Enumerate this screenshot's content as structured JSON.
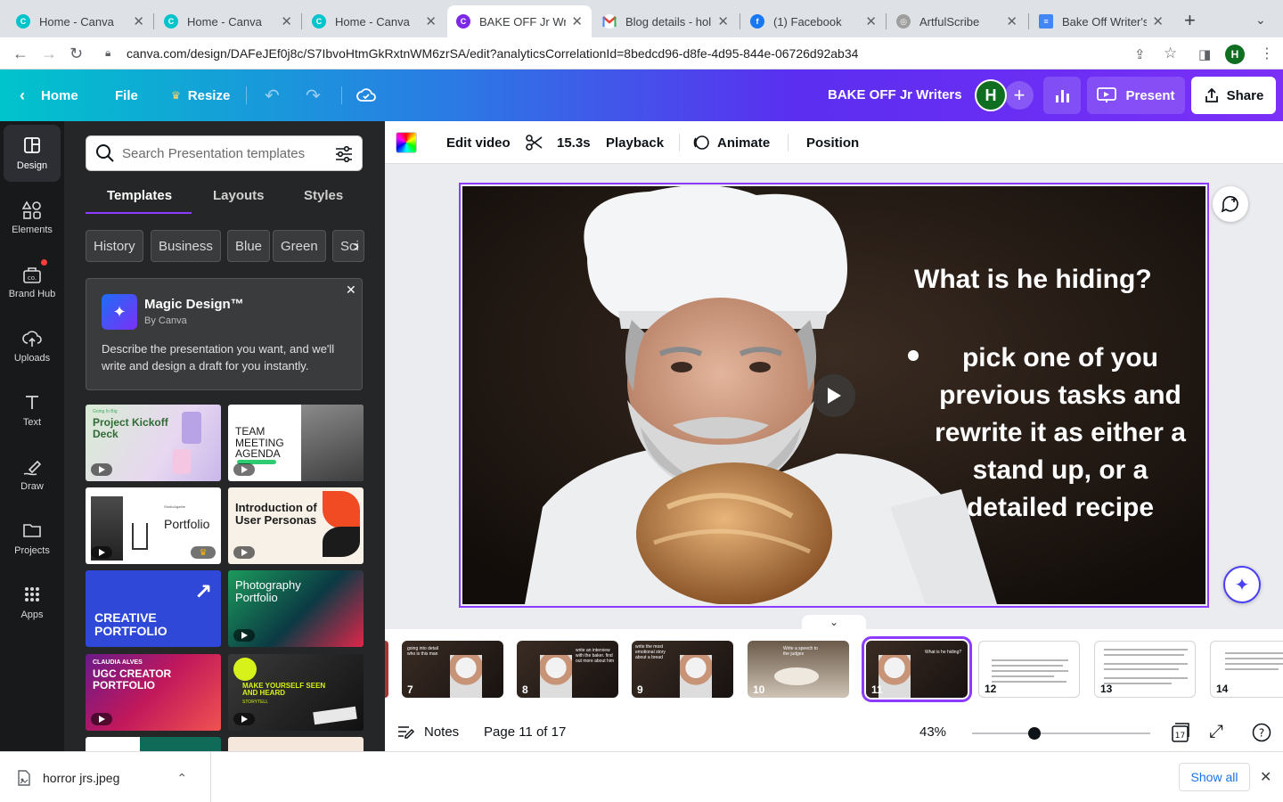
{
  "browser": {
    "tabs": [
      {
        "title": "Home - Canva",
        "favicon": "canva-icon",
        "active": false
      },
      {
        "title": "Home - Canva",
        "favicon": "canva-icon",
        "active": false
      },
      {
        "title": "Home - Canva",
        "favicon": "canva-icon",
        "active": false
      },
      {
        "title": "BAKE OFF Jr Writ",
        "favicon": "canva-icon",
        "active": true
      },
      {
        "title": "Blog details - holi",
        "favicon": "gmail-icon",
        "active": false
      },
      {
        "title": "(1) Facebook",
        "favicon": "facebook-icon",
        "active": false
      },
      {
        "title": "ArtfulScribe",
        "favicon": "artfulscribe-icon",
        "active": false
      },
      {
        "title": "Bake Off Writer's",
        "favicon": "docs-icon",
        "active": false
      }
    ],
    "url": "canva.com/design/DAFeJEf0j8c/S7IbvoHtmGkRxtnWM6zrSA/edit?analyticsCorrelationId=8bedcd96-d8fe-4d95-844e-06726d92ab34",
    "profile_initial": "H"
  },
  "topbar": {
    "home": "Home",
    "file": "File",
    "resize": "Resize",
    "design_title": "BAKE OFF Jr Writers",
    "avatar_initial": "H",
    "present": "Present",
    "share": "Share"
  },
  "rail": {
    "items": [
      {
        "label": "Design",
        "icon": "design-icon"
      },
      {
        "label": "Elements",
        "icon": "elements-icon"
      },
      {
        "label": "Brand Hub",
        "icon": "brand-hub-icon"
      },
      {
        "label": "Uploads",
        "icon": "uploads-icon"
      },
      {
        "label": "Text",
        "icon": "text-icon"
      },
      {
        "label": "Draw",
        "icon": "draw-icon"
      },
      {
        "label": "Projects",
        "icon": "projects-icon"
      },
      {
        "label": "Apps",
        "icon": "apps-icon"
      }
    ]
  },
  "panel": {
    "search_placeholder": "Search Presentation templates",
    "tabs": [
      "Templates",
      "Layouts",
      "Styles"
    ],
    "chips": [
      "History",
      "Business",
      "Blue",
      "Green",
      "Sci"
    ],
    "magic": {
      "title": "Magic Design™",
      "by": "By Canva",
      "description": "Describe the presentation you want, and we'll write and design a draft for you instantly."
    },
    "templates": [
      {
        "title": "Project Kickoff Deck",
        "kicker": "Going In Big"
      },
      {
        "title": "TEAM MEETING AGENDA"
      },
      {
        "title": "Portfolio",
        "kicker": "StudioAgathe"
      },
      {
        "title": "Introduction of User Personas"
      },
      {
        "title": "CREATIVE PORTFOLIO"
      },
      {
        "title": "Photography Portfolio"
      },
      {
        "title": "UGC CREATOR PORTFOLIO",
        "kicker": "CLAUDIA ALVES"
      },
      {
        "title": "MAKE YOURSELF SEEN AND HEARD",
        "kicker": "STORYTELL"
      }
    ]
  },
  "context_toolbar": {
    "edit_video": "Edit video",
    "duration": "15.3s",
    "playback": "Playback",
    "animate": "Animate",
    "position": "Position"
  },
  "slide": {
    "title": "What is he hiding?",
    "bullet": "pick one of you previous tasks and rewrite it as either a stand up, or a detailed recipe"
  },
  "filmstrip": {
    "pages": [
      {
        "num": "7",
        "style": "dark",
        "snippet": "going into detail who is this man"
      },
      {
        "num": "8",
        "style": "dark",
        "snippet": "write an interview with the baker. find out more about him"
      },
      {
        "num": "9",
        "style": "dark",
        "snippet": "write the most emotional story about a bread"
      },
      {
        "num": "10",
        "style": "dark",
        "snippet": "Write a speech to the judges"
      },
      {
        "num": "11",
        "style": "dark",
        "snippet": "What is he hiding?",
        "selected": true
      },
      {
        "num": "12",
        "style": "light"
      },
      {
        "num": "13",
        "style": "light"
      },
      {
        "num": "14",
        "style": "light"
      }
    ]
  },
  "bottombar": {
    "notes": "Notes",
    "page_info": "Page 11 of 17",
    "zoom": "43%",
    "zoom_fraction": 0.35,
    "page_count": "17"
  },
  "downloads": {
    "file": "horror jrs.jpeg",
    "show_all": "Show all"
  },
  "colors": {
    "accent": "#8b3dff",
    "rail_bg": "#18191b",
    "panel_bg": "#252627",
    "editor_bg": "#ebecf0"
  }
}
